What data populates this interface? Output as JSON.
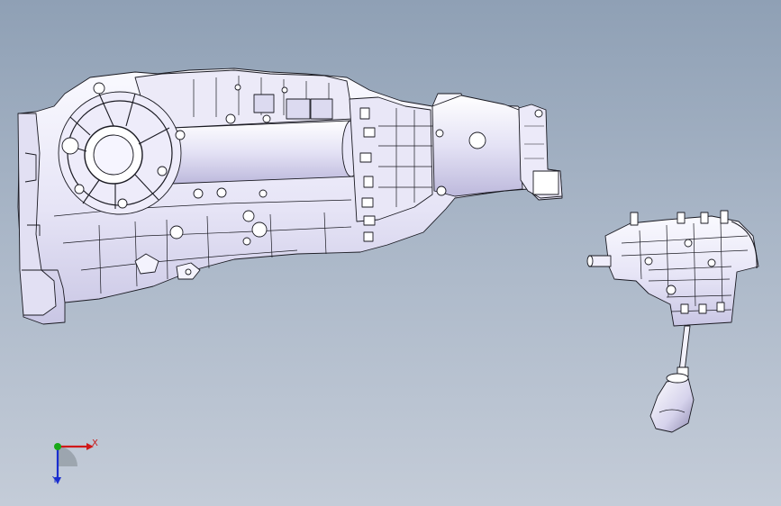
{
  "viewport": {
    "background_top": "#8fa0b5",
    "background_bottom": "#c4ccd8",
    "model_fill": "#f2f1fb",
    "model_shade": "#d8d6ee",
    "model_outline": "#1a1a22"
  },
  "parts": [
    {
      "name": "gearbox-assembly"
    },
    {
      "name": "shifter-assembly"
    }
  ],
  "triad": {
    "x_label": "X",
    "y_label": "Y",
    "x_color": "#d01818",
    "y_color": "#1a2ed0",
    "z_color": "#18a818"
  }
}
